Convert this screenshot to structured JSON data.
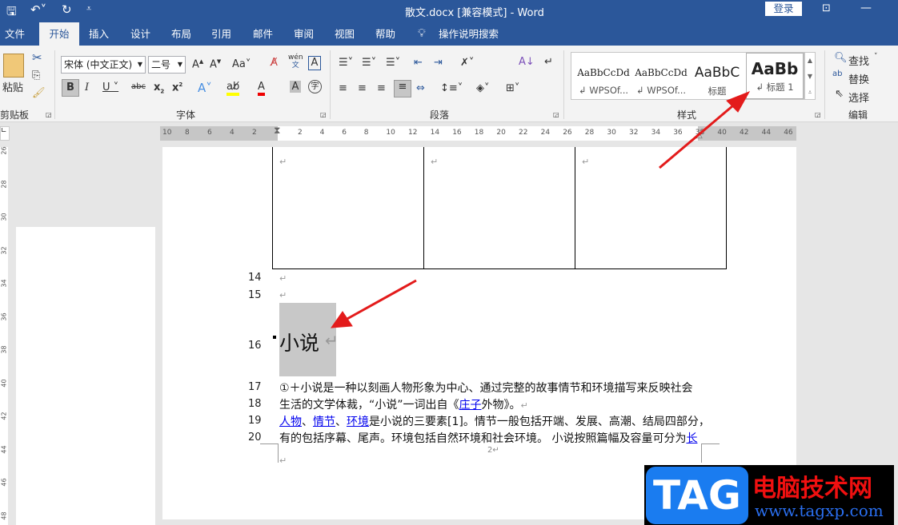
{
  "titlebar": {
    "title": "散文.docx [兼容模式]  -  Word",
    "login": "登录"
  },
  "tabs": [
    "文件",
    "开始",
    "插入",
    "设计",
    "布局",
    "引用",
    "邮件",
    "审阅",
    "视图",
    "帮助"
  ],
  "tell_me": "操作说明搜索",
  "clipboard": {
    "paste": "粘贴",
    "label": "剪贴板"
  },
  "font": {
    "name": "宋体 (中文正文)",
    "size": "二号",
    "label": "字体",
    "wen": "wén",
    "wen2": "文"
  },
  "paragraph": {
    "label": "段落"
  },
  "styles": {
    "label": "样式",
    "items": [
      {
        "sample": "AaBbCcDd",
        "name": "↲ WPSOf..."
      },
      {
        "sample": "AaBbCcDd",
        "name": "↲ WPSOf..."
      },
      {
        "sample": "AaBbC",
        "name": "标题"
      },
      {
        "sample": "AaBb",
        "name": "↲ 标题 1"
      }
    ]
  },
  "editing": {
    "label": "编辑",
    "find": "查找",
    "replace": "替换",
    "select": "选择"
  },
  "ruler": {
    "left": [
      "10",
      "8",
      "6",
      "4",
      "2"
    ],
    "right": [
      "2",
      "4",
      "6",
      "8",
      "10",
      "12",
      "14",
      "16",
      "18",
      "20",
      "22",
      "24",
      "26",
      "28",
      "30",
      "32",
      "34",
      "36",
      "38",
      "40",
      "42",
      "44",
      "46"
    ]
  },
  "vruler": [
    "26",
    "28",
    "30",
    "32",
    "34",
    "36",
    "38",
    "40",
    "42",
    "44",
    "46",
    "48"
  ],
  "doc": {
    "line_numbers": [
      "14",
      "15",
      "16",
      "17",
      "18",
      "19",
      "20"
    ],
    "heading": "小说",
    "l17": "①＋小说是一种以刻画人物形象为中心、通过完整的故事情节和环境描写来反映社会",
    "l18a": "生活的文学体裁，“小说”一词出自《",
    "l18link": "庄子",
    "l18b": "外物》。",
    "l19link1": "人物",
    "sep": "、",
    "l19link2": "情节",
    "l19link3": "环境",
    "l19b": "是小说的三要素[1]。情节一般包括开端、发展、高潮、结局四部分，",
    "l20": "有的包括序幕、尾声。环境包括自然环境和社会环境。 小说按照篇幅及容量可分为",
    "l20link": "长",
    "page_num": "2",
    "para_mark": "↵"
  },
  "watermark": {
    "logo": "TAG",
    "cn": "电脑技术网",
    "url": "www.tagxp.com"
  },
  "colors": {
    "brand": "#2b579a",
    "arrow": "#e31b1b",
    "link": "#0000ee"
  }
}
